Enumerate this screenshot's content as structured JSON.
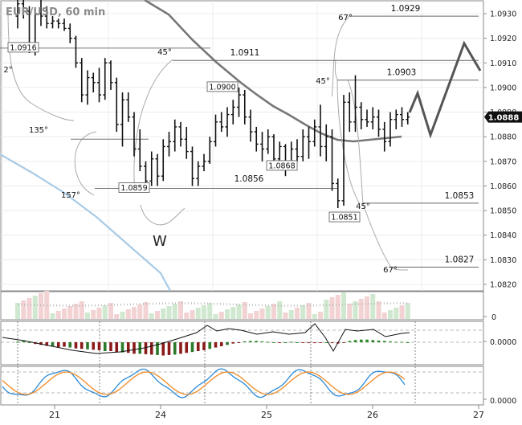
{
  "chart_data": [
    {
      "type": "candlestick",
      "title": "EUR/USD, 60 min",
      "ylim": [
        1.0815,
        1.0937
      ],
      "y_ticks": [
        "1.0930",
        "1.0920",
        "1.0910",
        "1.0900",
        "1.0890",
        "1.0880",
        "1.0870",
        "1.0860",
        "1.0850",
        "1.0840",
        "1.0830",
        "1.0820"
      ],
      "x_ticks": [
        "21",
        "24",
        "25",
        "26",
        "27"
      ],
      "last_price": "1.0888",
      "bars": [
        [
          1.0929,
          1.0937,
          1.0924,
          1.0934
        ],
        [
          1.0934,
          1.0937,
          1.0928,
          1.0931
        ],
        [
          1.0931,
          1.0933,
          1.0914,
          1.0916
        ],
        [
          1.0916,
          1.0932,
          1.0913,
          1.093
        ],
        [
          1.093,
          1.0936,
          1.0925,
          1.0929
        ],
        [
          1.0929,
          1.0933,
          1.0924,
          1.0926
        ],
        [
          1.0926,
          1.0929,
          1.0924,
          1.0927
        ],
        [
          1.0927,
          1.0928,
          1.0924,
          1.0926
        ],
        [
          1.0926,
          1.0928,
          1.0923,
          1.0924
        ],
        [
          1.0924,
          1.0926,
          1.0918,
          1.092
        ],
        [
          1.092,
          1.0921,
          1.0908,
          1.091
        ],
        [
          1.091,
          1.0912,
          1.0894,
          1.0897
        ],
        [
          1.0897,
          1.0907,
          1.0893,
          1.0904
        ],
        [
          1.0904,
          1.0906,
          1.0898,
          1.0902
        ],
        [
          1.0902,
          1.0908,
          1.0894,
          1.0897
        ],
        [
          1.0897,
          1.0912,
          1.0895,
          1.091
        ],
        [
          1.091,
          1.0911,
          1.0899,
          1.0902
        ],
        [
          1.0902,
          1.0904,
          1.0882,
          1.0885
        ],
        [
          1.0885,
          1.0898,
          1.0876,
          1.0895
        ],
        [
          1.0895,
          1.0898,
          1.0886,
          1.0888
        ],
        [
          1.0888,
          1.089,
          1.0872,
          1.0875
        ],
        [
          1.0875,
          1.0883,
          1.0866,
          1.0868
        ],
        [
          1.0868,
          1.087,
          1.0859,
          1.0862
        ],
        [
          1.0862,
          1.0874,
          1.086,
          1.0871
        ],
        [
          1.0871,
          1.0873,
          1.086,
          1.0864
        ],
        [
          1.0864,
          1.0879,
          1.0862,
          1.0876
        ],
        [
          1.0876,
          1.0882,
          1.0872,
          1.0878
        ],
        [
          1.0878,
          1.0887,
          1.0874,
          1.0884
        ],
        [
          1.0884,
          1.0886,
          1.0876,
          1.0879
        ],
        [
          1.0879,
          1.0884,
          1.0871,
          1.0874
        ],
        [
          1.0874,
          1.0876,
          1.086,
          1.0863
        ],
        [
          1.0863,
          1.087,
          1.086,
          1.0868
        ],
        [
          1.0868,
          1.0873,
          1.0866,
          1.087
        ],
        [
          1.087,
          1.088,
          1.0869,
          1.0878
        ],
        [
          1.0878,
          1.0889,
          1.0876,
          1.0886
        ],
        [
          1.0886,
          1.089,
          1.0882,
          1.0884
        ],
        [
          1.0884,
          1.0892,
          1.088,
          1.0889
        ],
        [
          1.0889,
          1.0895,
          1.0885,
          1.0892
        ],
        [
          1.0892,
          1.09,
          1.0888,
          1.0897
        ],
        [
          1.0897,
          1.0899,
          1.0885,
          1.0888
        ],
        [
          1.0888,
          1.0891,
          1.0878,
          1.0882
        ],
        [
          1.0882,
          1.0884,
          1.0874,
          1.0877
        ],
        [
          1.0877,
          1.0882,
          1.087,
          1.0875
        ],
        [
          1.0875,
          1.0883,
          1.0873,
          1.088
        ],
        [
          1.088,
          1.0881,
          1.0868,
          1.0871
        ],
        [
          1.0871,
          1.0878,
          1.0868,
          1.0876
        ],
        [
          1.0876,
          1.0877,
          1.0864,
          1.0869
        ],
        [
          1.0869,
          1.0878,
          1.0867,
          1.0875
        ],
        [
          1.0875,
          1.0879,
          1.087,
          1.0872
        ],
        [
          1.0872,
          1.0883,
          1.087,
          1.088
        ],
        [
          1.088,
          1.0884,
          1.0871,
          1.0878
        ],
        [
          1.0878,
          1.0887,
          1.0876,
          1.0884
        ],
        [
          1.0884,
          1.0893,
          1.0872,
          1.0876
        ],
        [
          1.0876,
          1.0885,
          1.087,
          1.088
        ],
        [
          1.088,
          1.0883,
          1.0858,
          1.0861
        ],
        [
          1.0861,
          1.0863,
          1.0851,
          1.0854
        ],
        [
          1.0854,
          1.0897,
          1.0852,
          1.0894
        ],
        [
          1.0894,
          1.0898,
          1.0882,
          1.0886
        ],
        [
          1.0886,
          1.0905,
          1.0882,
          1.0892
        ],
        [
          1.0892,
          1.0894,
          1.0883,
          1.0887
        ],
        [
          1.0887,
          1.0891,
          1.0884,
          1.0886
        ],
        [
          1.0886,
          1.0892,
          1.0883,
          1.0888
        ],
        [
          1.0888,
          1.0891,
          1.088,
          1.0883
        ],
        [
          1.0883,
          1.0886,
          1.0874,
          1.0878
        ],
        [
          1.0878,
          1.089,
          1.0876,
          1.0887
        ],
        [
          1.0887,
          1.0891,
          1.0883,
          1.0889
        ],
        [
          1.0889,
          1.0892,
          1.0884,
          1.0887
        ],
        [
          1.0887,
          1.089,
          1.0885,
          1.0888
        ]
      ],
      "levels": [
        {
          "label": "1.0929",
          "value": 1.0929
        },
        {
          "label": "1.0911",
          "value": 1.0911
        },
        {
          "label": "1.0903",
          "value": 1.0903
        },
        {
          "label": "1.0853",
          "value": 1.0853
        },
        {
          "label": "1.0827",
          "value": 1.0827
        }
      ],
      "price_boxes": [
        {
          "label": "1.0916",
          "value": 1.0916
        },
        {
          "label": "1.0900",
          "value": 1.09
        },
        {
          "label": "1.0868",
          "value": 1.0868
        },
        {
          "label": "1.0859",
          "value": 1.0859
        },
        {
          "label": "1.0851",
          "value": 1.0851
        }
      ],
      "plain_labels": [
        "1.0856"
      ],
      "angles": [
        "67°",
        "45°",
        "45°",
        "135°",
        "157°",
        "45°",
        "67°",
        "2°"
      ],
      "pattern_label": "W",
      "forecast_path": [
        1.0889,
        1.0882,
        1.0918,
        1.0902
      ]
    },
    {
      "type": "volume_bar",
      "y_ticks": [
        "0"
      ]
    },
    {
      "type": "histogram_oscillator",
      "y_ticks": [
        "0.0000"
      ]
    },
    {
      "type": "line",
      "series": [
        {
          "color": "#2a8ad8"
        },
        {
          "color": "#f08a24"
        }
      ],
      "y_ticks": [
        "0.0000"
      ]
    }
  ]
}
